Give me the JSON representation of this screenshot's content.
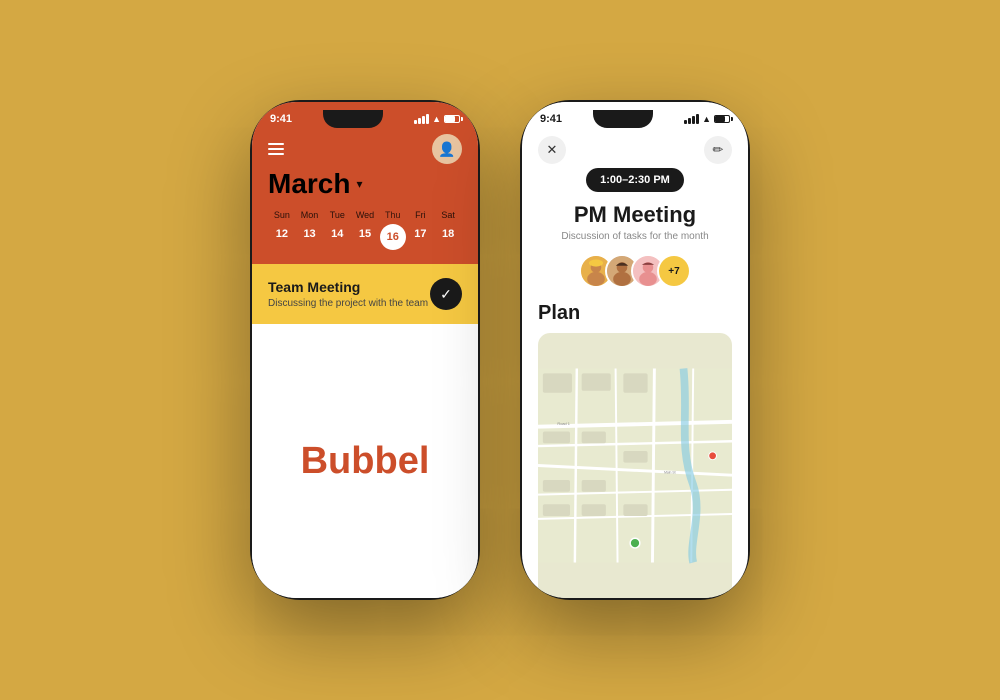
{
  "background": "#D4A843",
  "phone1": {
    "status_time": "9:41",
    "month": "March",
    "calendar_headers": [
      "Sun",
      "Mon",
      "Tue",
      "Wed",
      "Thu",
      "Fri",
      "Sat"
    ],
    "calendar_days": [
      "12",
      "13",
      "14",
      "15",
      "16",
      "17",
      "18"
    ],
    "active_day": "16",
    "active_day_label": "Thu",
    "meeting_title": "Team Meeting",
    "meeting_desc": "Discussing the project with the team",
    "brand_name": "Bubbel"
  },
  "phone2": {
    "status_time": "9:41",
    "time_range": "1:00–2:30 PM",
    "meeting_title": "PM Meeting",
    "meeting_desc": "Discussion of tasks for the month",
    "extra_attendees": "+7",
    "plan_title": "Plan",
    "close_icon": "✕",
    "edit_icon": "✏"
  }
}
